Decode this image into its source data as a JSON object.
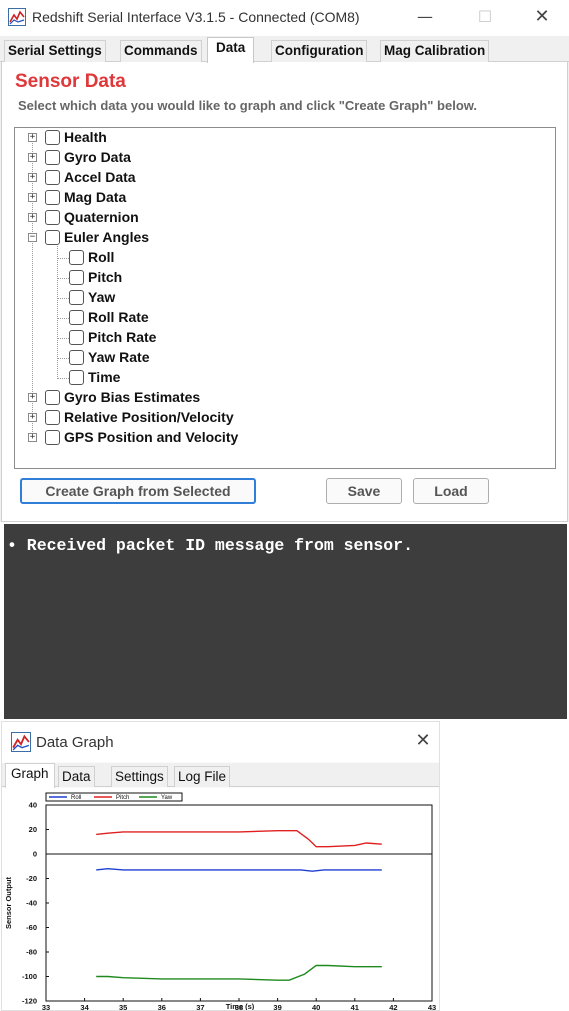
{
  "main_window": {
    "title": "Redshift Serial Interface V3.1.5 - Connected (COM8)",
    "minimize_glyph": "—",
    "maximize_glyph": "☐",
    "close_glyph": "✕",
    "tabs": [
      {
        "label": "Serial Settings",
        "active": false
      },
      {
        "label": "Commands",
        "active": false
      },
      {
        "label": "Data",
        "active": true
      },
      {
        "label": "Configuration",
        "active": false
      },
      {
        "label": "Mag Calibration",
        "active": false
      }
    ],
    "panel_title": "Sensor Data",
    "panel_subtitle": "Select which data you would like to graph and click \"Create Graph\" below.",
    "tree": [
      {
        "label": "Health",
        "expander": "+"
      },
      {
        "label": "Gyro Data",
        "expander": "+"
      },
      {
        "label": "Accel Data",
        "expander": "+"
      },
      {
        "label": "Mag Data",
        "expander": "+"
      },
      {
        "label": "Quaternion",
        "expander": "+"
      },
      {
        "label": "Euler Angles",
        "expander": "−",
        "children": [
          "Roll",
          "Pitch",
          "Yaw",
          "Roll Rate",
          "Pitch Rate",
          "Yaw Rate",
          "Time"
        ]
      },
      {
        "label": "Gyro Bias Estimates",
        "expander": "+"
      },
      {
        "label": "Relative Position/Velocity",
        "expander": "+"
      },
      {
        "label": "GPS Position and Velocity",
        "expander": "+"
      }
    ],
    "buttons": {
      "create_graph": "Create Graph from Selected",
      "save": "Save",
      "load": "Load"
    },
    "colors": {
      "title_red": "#e0383a",
      "focus_blue": "#2f7ed8"
    }
  },
  "console": {
    "lines": [
      "• Received packet ID message from sensor."
    ],
    "background": "#3d3d3d"
  },
  "graph_window": {
    "title": "Data Graph",
    "close_glyph": "✕",
    "tabs": [
      {
        "label": "Graph",
        "active": true
      },
      {
        "label": "Data",
        "active": false
      },
      {
        "label": "Settings",
        "active": false
      },
      {
        "label": "Log File",
        "active": false
      }
    ]
  },
  "chart_data": {
    "type": "line",
    "title": "",
    "xlabel": "Time (s)",
    "ylabel": "Sensor Output",
    "xlim": [
      33,
      43
    ],
    "ylim": [
      -120,
      40
    ],
    "x_ticks": [
      33,
      34,
      35,
      36,
      37,
      38,
      39,
      40,
      41,
      42,
      43
    ],
    "y_ticks": [
      40,
      20,
      0,
      -20,
      -40,
      -60,
      -80,
      -100,
      -120
    ],
    "legend_position": "top",
    "grid": false,
    "series": [
      {
        "name": "Roll",
        "color": "#1f3fd0",
        "x": [
          34.3,
          34.6,
          35.0,
          36.0,
          37.0,
          38.0,
          39.0,
          39.6,
          39.9,
          40.2,
          41.0,
          41.7
        ],
        "values": [
          -13,
          -12,
          -13,
          -13,
          -13,
          -13,
          -13,
          -13,
          -14,
          -13,
          -13,
          -13
        ]
      },
      {
        "name": "Pitch",
        "color": "#e02020",
        "x": [
          34.3,
          34.6,
          35.0,
          36.0,
          37.0,
          38.0,
          39.0,
          39.5,
          39.8,
          40.0,
          40.3,
          41.0,
          41.3,
          41.7
        ],
        "values": [
          16,
          17,
          18,
          18,
          18,
          18,
          19,
          19,
          12,
          6,
          6,
          7,
          9,
          8
        ]
      },
      {
        "name": "Yaw",
        "color": "#1e8a1e",
        "x": [
          34.3,
          34.6,
          35.0,
          36.0,
          37.0,
          38.0,
          39.0,
          39.3,
          39.7,
          40.0,
          40.3,
          41.0,
          41.7
        ],
        "values": [
          -100,
          -100,
          -101,
          -102,
          -102,
          -102,
          -103,
          -103,
          -98,
          -91,
          -91,
          -92,
          -92
        ]
      }
    ]
  }
}
